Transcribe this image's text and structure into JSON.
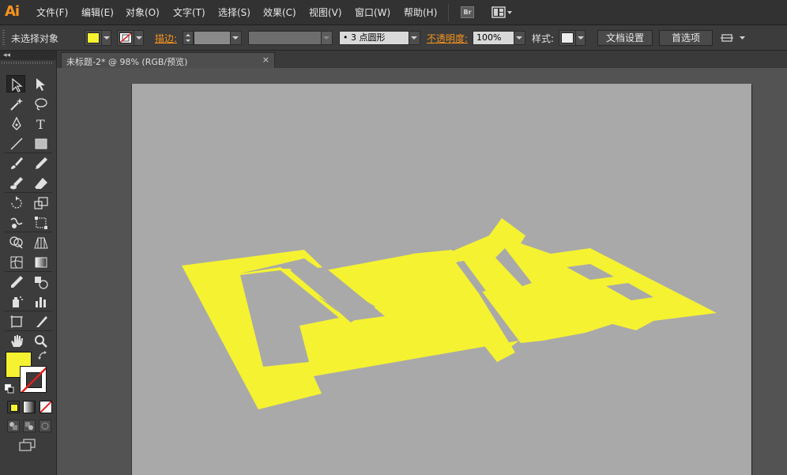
{
  "app": {
    "logo": "Ai"
  },
  "menu": [
    {
      "name": "menu-file",
      "label": "文件(F)"
    },
    {
      "name": "menu-edit",
      "label": "编辑(E)"
    },
    {
      "name": "menu-object",
      "label": "对象(O)"
    },
    {
      "name": "menu-type",
      "label": "文字(T)"
    },
    {
      "name": "menu-select",
      "label": "选择(S)"
    },
    {
      "name": "menu-effect",
      "label": "效果(C)"
    },
    {
      "name": "menu-view",
      "label": "视图(V)"
    },
    {
      "name": "menu-window",
      "label": "窗口(W)"
    },
    {
      "name": "menu-help",
      "label": "帮助(H)"
    }
  ],
  "bridge_label": "Br",
  "control": {
    "selection_status": "未选择对象",
    "stroke_label": "描边:",
    "brush_value": "• 3 点圆形",
    "opacity_label": "不透明度:",
    "opacity_value": "100%",
    "style_label": "样式:",
    "doc_setup_button": "文档设置",
    "preferences_button": "首选项"
  },
  "colors": {
    "fill": "#f5f232",
    "stroke": "none",
    "artboard": "#a9a9a9",
    "accent": "#f7941e"
  },
  "document_tab": {
    "title": "未标题-2* @ 98% (RGB/预览)",
    "close": "×"
  },
  "tools": [
    "selection-tool",
    "direct-selection-tool",
    "magic-wand-tool",
    "lasso-tool",
    "pen-tool",
    "type-tool",
    "line-segment-tool",
    "rectangle-tool",
    "paintbrush-tool",
    "pencil-tool",
    "blob-brush-tool",
    "eraser-tool",
    "rotate-tool",
    "scale-tool",
    "warp-tool",
    "free-transform-tool",
    "shape-builder-tool",
    "perspective-grid-tool",
    "mesh-tool",
    "gradient-tool",
    "eyedropper-tool",
    "blend-tool",
    "symbol-sprayer-tool",
    "column-graph-tool",
    "artboard-tool",
    "slice-tool",
    "hand-tool",
    "zoom-tool"
  ]
}
